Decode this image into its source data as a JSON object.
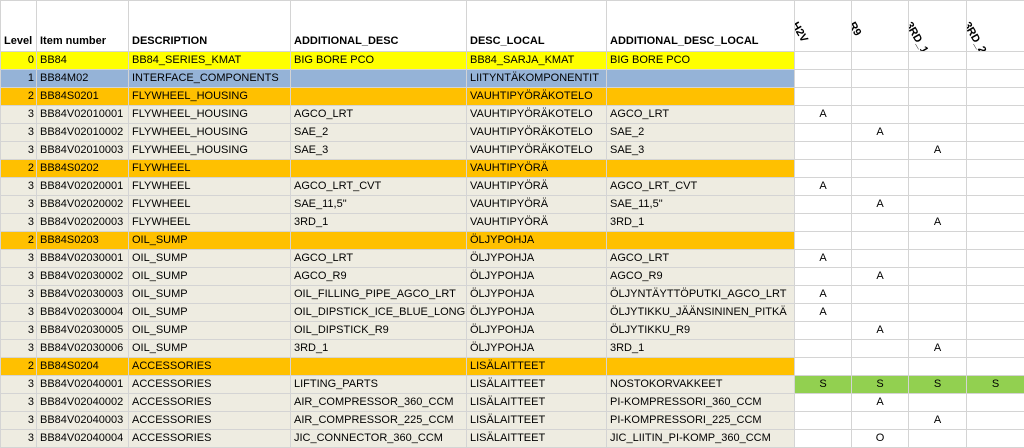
{
  "headers": {
    "level": "Level",
    "item": "Item number",
    "desc": "DESCRIPTION",
    "add": "ADDITIONAL_DESC",
    "local": "DESC_LOCAL",
    "addlocal": "ADDITIONAL_DESC_LOCAL",
    "flags": [
      "H2V",
      "R9",
      "3RD_1",
      "3RD_2"
    ]
  },
  "colors": {
    "yellow": "#ffff00",
    "blue": "#95b3d7",
    "orange": "#ffc000",
    "gray": "#eeece1",
    "green": "#92d050"
  },
  "rows": [
    {
      "level": "0",
      "item": "BB84",
      "desc": "BB84_SERIES_KMAT",
      "add": "BIG BORE PCO",
      "local": "BB84_SARJA_KMAT",
      "addlocal": "BIG BORE PCO",
      "style": "yellow",
      "flags": [
        "",
        "",
        "",
        ""
      ],
      "greenflags": false
    },
    {
      "level": "1",
      "item": "BB84M02",
      "desc": "INTERFACE_COMPONENTS",
      "add": "",
      "local": "LIITYNTÄKOMPONENTIT",
      "addlocal": "",
      "style": "blue",
      "flags": [
        "",
        "",
        "",
        ""
      ],
      "greenflags": false
    },
    {
      "level": "2",
      "item": "BB84S0201",
      "desc": "FLYWHEEL_HOUSING",
      "add": "",
      "local": "VAUHTIPYÖRÄKOTELO",
      "addlocal": "",
      "style": "orange",
      "flags": [
        "",
        "",
        "",
        ""
      ],
      "greenflags": false
    },
    {
      "level": "3",
      "item": "BB84V02010001",
      "desc": "FLYWHEEL_HOUSING",
      "add": "AGCO_LRT",
      "local": "VAUHTIPYÖRÄKOTELO",
      "addlocal": "AGCO_LRT",
      "style": "gray",
      "flags": [
        "A",
        "",
        "",
        ""
      ],
      "greenflags": false
    },
    {
      "level": "3",
      "item": "BB84V02010002",
      "desc": "FLYWHEEL_HOUSING",
      "add": "SAE_2",
      "local": "VAUHTIPYÖRÄKOTELO",
      "addlocal": "SAE_2",
      "style": "gray",
      "flags": [
        "",
        "A",
        "",
        ""
      ],
      "greenflags": false
    },
    {
      "level": "3",
      "item": "BB84V02010003",
      "desc": "FLYWHEEL_HOUSING",
      "add": "SAE_3",
      "local": "VAUHTIPYÖRÄKOTELO",
      "addlocal": "SAE_3",
      "style": "gray",
      "flags": [
        "",
        "",
        "A",
        ""
      ],
      "greenflags": false
    },
    {
      "level": "2",
      "item": "BB84S0202",
      "desc": "FLYWHEEL",
      "add": "",
      "local": "VAUHTIPYÖRÄ",
      "addlocal": "",
      "style": "orange",
      "flags": [
        "",
        "",
        "",
        ""
      ],
      "greenflags": false
    },
    {
      "level": "3",
      "item": "BB84V02020001",
      "desc": "FLYWHEEL",
      "add": "AGCO_LRT_CVT",
      "local": "VAUHTIPYÖRÄ",
      "addlocal": "AGCO_LRT_CVT",
      "style": "gray",
      "flags": [
        "A",
        "",
        "",
        ""
      ],
      "greenflags": false
    },
    {
      "level": "3",
      "item": "BB84V02020002",
      "desc": "FLYWHEEL",
      "add": "SAE_11,5\"",
      "local": "VAUHTIPYÖRÄ",
      "addlocal": "SAE_11,5\"",
      "style": "gray",
      "flags": [
        "",
        "A",
        "",
        ""
      ],
      "greenflags": false
    },
    {
      "level": "3",
      "item": "BB84V02020003",
      "desc": "FLYWHEEL",
      "add": "3RD_1",
      "local": "VAUHTIPYÖRÄ",
      "addlocal": "3RD_1",
      "style": "gray",
      "flags": [
        "",
        "",
        "A",
        ""
      ],
      "greenflags": false
    },
    {
      "level": "2",
      "item": "BB84S0203",
      "desc": "OIL_SUMP",
      "add": "",
      "local": "ÖLJYPOHJA",
      "addlocal": "",
      "style": "orange",
      "flags": [
        "",
        "",
        "",
        ""
      ],
      "greenflags": false
    },
    {
      "level": "3",
      "item": "BB84V02030001",
      "desc": "OIL_SUMP",
      "add": "AGCO_LRT",
      "local": "ÖLJYPOHJA",
      "addlocal": "AGCO_LRT",
      "style": "gray",
      "flags": [
        "A",
        "",
        "",
        ""
      ],
      "greenflags": false
    },
    {
      "level": "3",
      "item": "BB84V02030002",
      "desc": "OIL_SUMP",
      "add": "AGCO_R9",
      "local": "ÖLJYPOHJA",
      "addlocal": "AGCO_R9",
      "style": "gray",
      "flags": [
        "",
        "A",
        "",
        ""
      ],
      "greenflags": false
    },
    {
      "level": "3",
      "item": "BB84V02030003",
      "desc": "OIL_SUMP",
      "add": "OIL_FILLING_PIPE_AGCO_LRT",
      "local": "ÖLJYPOHJA",
      "addlocal": "ÖLJYNTÄYTTÖPUTKI_AGCO_LRT",
      "style": "gray",
      "flags": [
        "A",
        "",
        "",
        ""
      ],
      "greenflags": false
    },
    {
      "level": "3",
      "item": "BB84V02030004",
      "desc": "OIL_SUMP",
      "add": "OIL_DIPSTICK_ICE_BLUE_LONG",
      "local": "ÖLJYPOHJA",
      "addlocal": "ÖLJYTIKKU_JÄÄNSININEN_PITKÄ",
      "style": "gray",
      "flags": [
        "A",
        "",
        "",
        ""
      ],
      "greenflags": false
    },
    {
      "level": "3",
      "item": "BB84V02030005",
      "desc": "OIL_SUMP",
      "add": "OIL_DIPSTICK_R9",
      "local": "ÖLJYPOHJA",
      "addlocal": "ÖLJYTIKKU_R9",
      "style": "gray",
      "flags": [
        "",
        "A",
        "",
        ""
      ],
      "greenflags": false
    },
    {
      "level": "3",
      "item": "BB84V02030006",
      "desc": "OIL_SUMP",
      "add": "3RD_1",
      "local": "ÖLJYPOHJA",
      "addlocal": "3RD_1",
      "style": "gray",
      "flags": [
        "",
        "",
        "A",
        ""
      ],
      "greenflags": false
    },
    {
      "level": "2",
      "item": "BB84S0204",
      "desc": "ACCESSORIES",
      "add": "",
      "local": "LISÄLAITTEET",
      "addlocal": "",
      "style": "orange",
      "flags": [
        "",
        "",
        "",
        ""
      ],
      "greenflags": false
    },
    {
      "level": "3",
      "item": "BB84V02040001",
      "desc": "ACCESSORIES",
      "add": "LIFTING_PARTS",
      "local": "LISÄLAITTEET",
      "addlocal": "NOSTOKORVAKKEET",
      "style": "gray",
      "flags": [
        "S",
        "S",
        "S",
        "S"
      ],
      "greenflags": true
    },
    {
      "level": "3",
      "item": "BB84V02040002",
      "desc": "ACCESSORIES",
      "add": "AIR_COMPRESSOR_360_CCM",
      "local": "LISÄLAITTEET",
      "addlocal": "PI-KOMPRESSORI_360_CCM",
      "style": "gray",
      "flags": [
        "",
        "A",
        "",
        ""
      ],
      "greenflags": false
    },
    {
      "level": "3",
      "item": "BB84V02040003",
      "desc": "ACCESSORIES",
      "add": "AIR_COMPRESSOR_225_CCM",
      "local": "LISÄLAITTEET",
      "addlocal": "PI-KOMPRESSORI_225_CCM",
      "style": "gray",
      "flags": [
        "",
        "",
        "A",
        ""
      ],
      "greenflags": false
    },
    {
      "level": "3",
      "item": "BB84V02040004",
      "desc": "ACCESSORIES",
      "add": "JIC_CONNECTOR_360_CCM",
      "local": "LISÄLAITTEET",
      "addlocal": "JIC_LIITIN_PI-KOMP_360_CCM",
      "style": "gray",
      "flags": [
        "",
        "O",
        "",
        ""
      ],
      "greenflags": false
    }
  ]
}
